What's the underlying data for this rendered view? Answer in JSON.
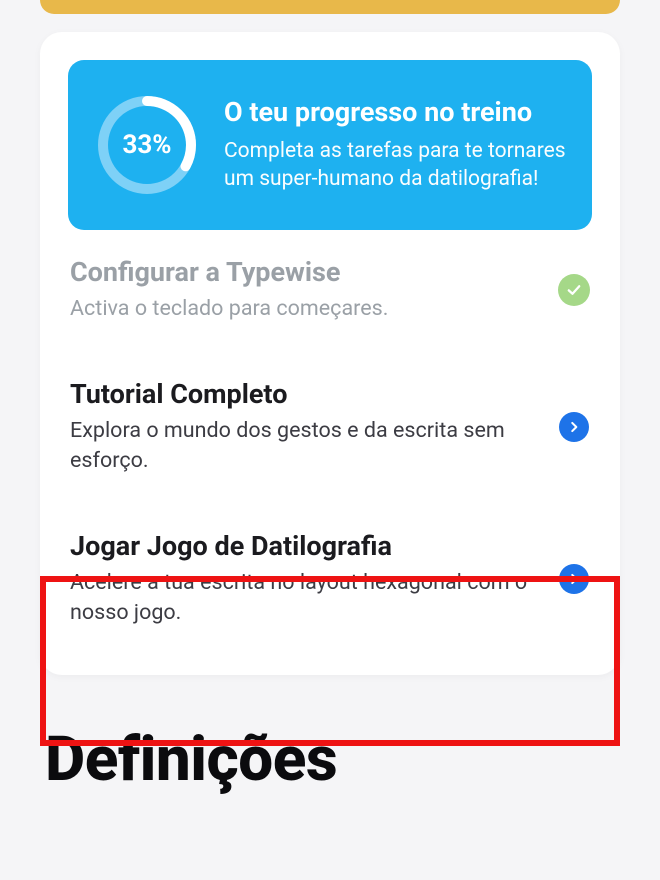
{
  "progress": {
    "percent_label": "33%",
    "title": "O teu progresso no treino",
    "subtitle": "Completa as tarefas para te tornares um super-humano da datilografia!"
  },
  "tasks": {
    "configure": {
      "title": "Configurar a Typewise",
      "subtitle": "Activa o teclado para começares."
    },
    "tutorial": {
      "title": "Tutorial Completo",
      "subtitle": "Explora o mundo dos gestos e da escrita sem esforço."
    },
    "game": {
      "title": "Jogar Jogo de Datilografia",
      "subtitle": "Acelere a tua escrita no layout hexagonal com o nosso jogo."
    }
  },
  "section_heading": "Definições"
}
